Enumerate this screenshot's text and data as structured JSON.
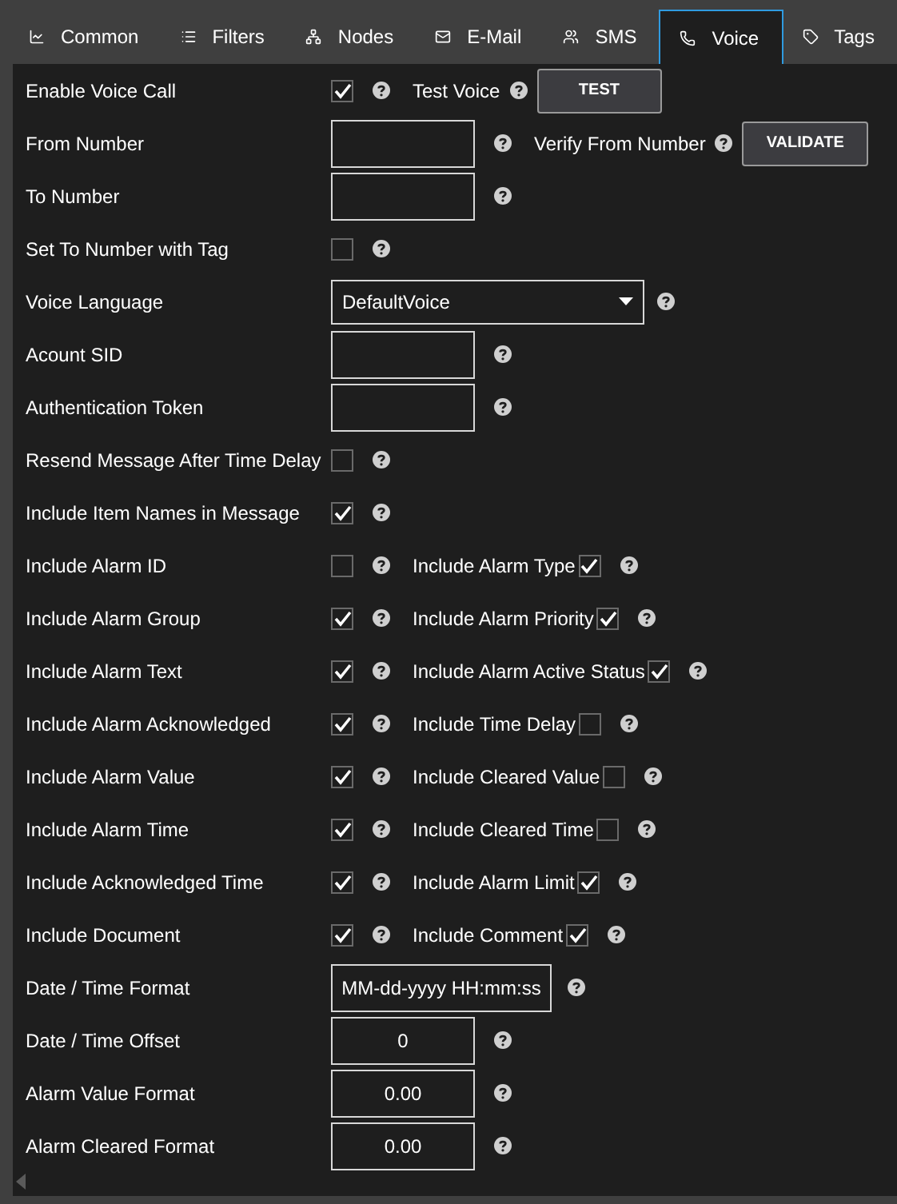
{
  "tabs": [
    {
      "label": "Common",
      "kind": "chart",
      "selected": false
    },
    {
      "label": "Filters",
      "kind": "list",
      "selected": false
    },
    {
      "label": "Nodes",
      "kind": "nodes",
      "selected": false
    },
    {
      "label": "E-Mail",
      "kind": "mail",
      "selected": false
    },
    {
      "label": "SMS",
      "kind": "people",
      "selected": false
    },
    {
      "label": "Voice",
      "kind": "phone",
      "selected": true
    },
    {
      "label": "Tags",
      "kind": "tag",
      "selected": false
    }
  ],
  "rows": [
    {
      "label": "Enable Voice Call",
      "control": {
        "kind": "checkbox",
        "checked": true
      },
      "extra": {
        "kind": "button",
        "label": "Test Voice",
        "button": "TEST"
      }
    },
    {
      "label": "From Number",
      "control": {
        "kind": "input"
      },
      "extra": {
        "kind": "button",
        "label": "Verify From Number",
        "button": "VALIDATE"
      }
    },
    {
      "label": "To Number",
      "control": {
        "kind": "input"
      }
    },
    {
      "label": "Set To Number with Tag",
      "control": {
        "kind": "checkbox",
        "checked": false
      }
    },
    {
      "label": "Voice Language",
      "control": {
        "kind": "select",
        "value": "DefaultVoice"
      }
    },
    {
      "label": "Acount SID",
      "control": {
        "kind": "input"
      }
    },
    {
      "label": "Authentication Token",
      "control": {
        "kind": "input"
      }
    },
    {
      "label": "Resend Message After Time Delay",
      "control": {
        "kind": "checkbox",
        "checked": false
      }
    },
    {
      "label": "Include Item Names in Message",
      "control": {
        "kind": "checkbox",
        "checked": true
      }
    },
    {
      "label": "Include Alarm ID",
      "control": {
        "kind": "checkbox",
        "checked": false
      },
      "extra": {
        "kind": "checkbox",
        "label": "Include Alarm Type",
        "checked": true
      }
    },
    {
      "label": "Include Alarm Group",
      "control": {
        "kind": "checkbox",
        "checked": true
      },
      "extra": {
        "kind": "checkbox",
        "label": "Include Alarm Priority",
        "checked": true
      }
    },
    {
      "label": "Include Alarm Text",
      "control": {
        "kind": "checkbox",
        "checked": true
      },
      "extra": {
        "kind": "checkbox",
        "label": "Include Alarm Active Status",
        "checked": true
      }
    },
    {
      "label": "Include Alarm Acknowledged",
      "control": {
        "kind": "checkbox",
        "checked": true
      },
      "extra": {
        "kind": "checkbox",
        "label": "Include Time Delay",
        "checked": false
      }
    },
    {
      "label": "Include Alarm Value",
      "control": {
        "kind": "checkbox",
        "checked": true
      },
      "extra": {
        "kind": "checkbox",
        "label": "Include Cleared Value",
        "checked": false
      }
    },
    {
      "label": "Include Alarm Time",
      "control": {
        "kind": "checkbox",
        "checked": true
      },
      "extra": {
        "kind": "checkbox",
        "label": "Include Cleared Time",
        "checked": false
      }
    },
    {
      "label": "Include Acknowledged Time",
      "control": {
        "kind": "checkbox",
        "checked": true
      },
      "extra": {
        "kind": "checkbox",
        "label": "Include Alarm Limit",
        "checked": true
      }
    },
    {
      "label": "Include Document",
      "control": {
        "kind": "checkbox",
        "checked": true
      },
      "extra": {
        "kind": "checkbox",
        "label": "Include Comment",
        "checked": true
      }
    },
    {
      "label": "Date / Time Format",
      "control": {
        "kind": "wide-input",
        "value": "MM-dd-yyyy HH:mm:ss"
      }
    },
    {
      "label": "Date / Time Offset",
      "control": {
        "kind": "input",
        "value": "0"
      }
    },
    {
      "label": "Alarm Value Format",
      "control": {
        "kind": "input",
        "value": "0.00"
      }
    },
    {
      "label": "Alarm Cleared Format",
      "control": {
        "kind": "input",
        "value": "0.00"
      }
    }
  ]
}
